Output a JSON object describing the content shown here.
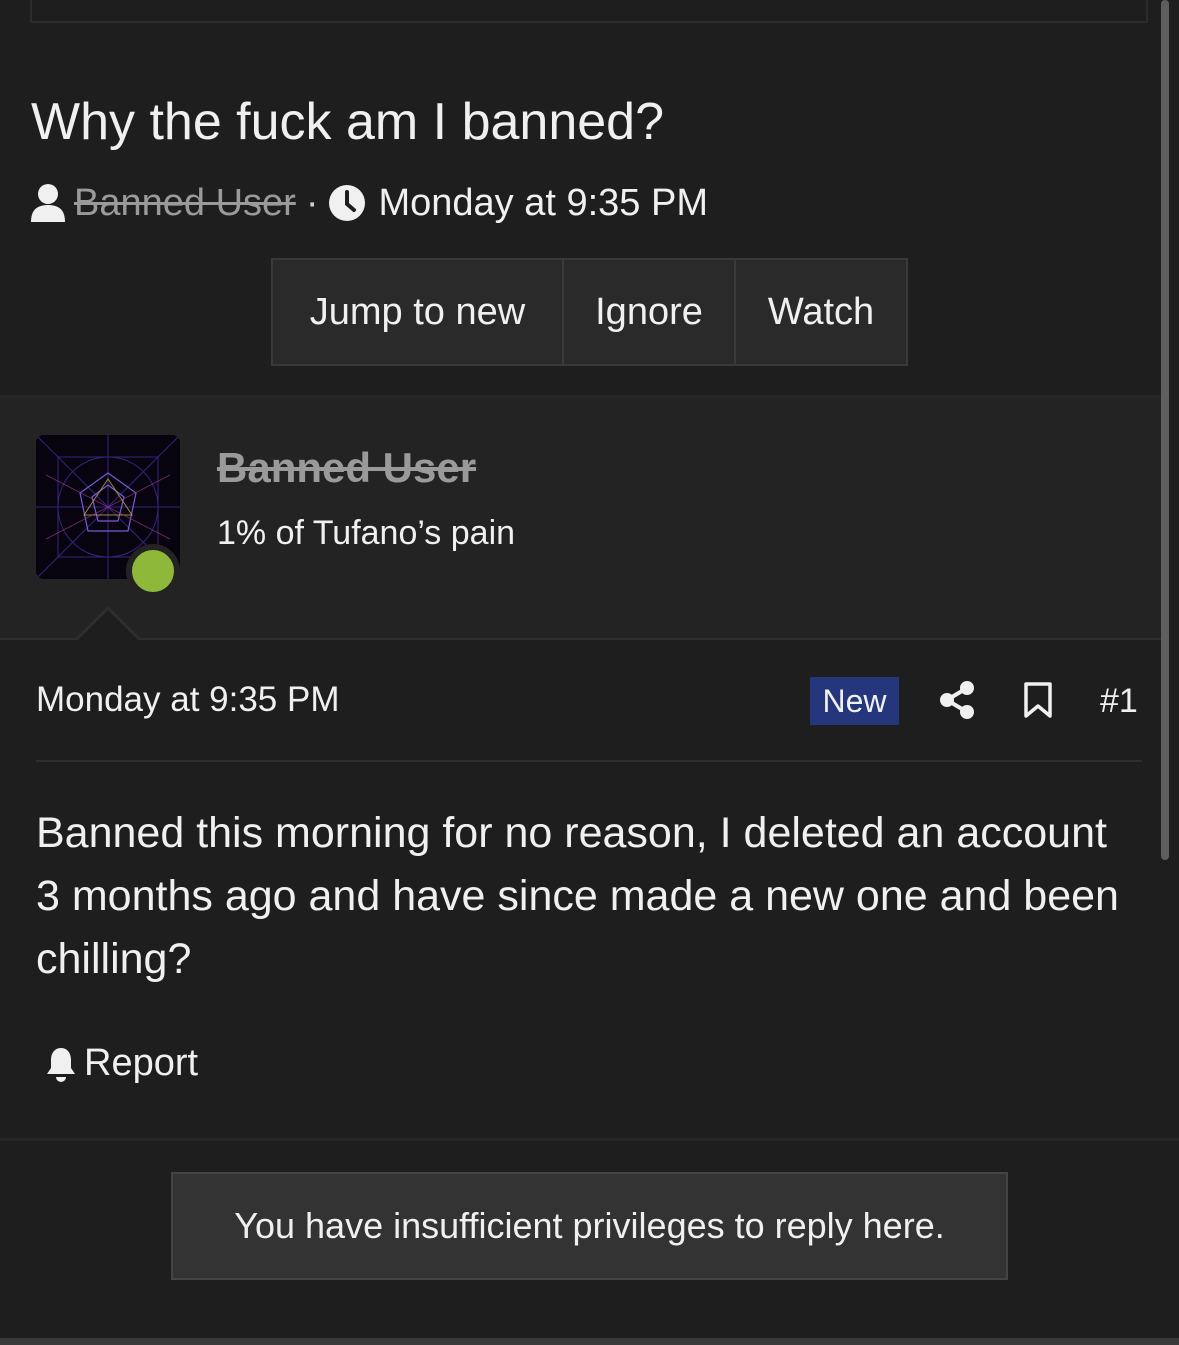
{
  "thread": {
    "title": "Why the fuck am I banned?",
    "author": "Banned User",
    "separator": "·",
    "timestamp": "Monday at 9:35 PM"
  },
  "actions": {
    "jump_label": "Jump to new",
    "ignore_label": "Ignore",
    "watch_label": "Watch"
  },
  "post": {
    "author_name": "Banned User",
    "author_title": "1% of Tufano’s pain",
    "timestamp": "Monday at 9:35 PM",
    "badge": "New",
    "number": "#1",
    "body": "Banned this morning for no reason, I deleted an account 3 months ago and have since made a new one and been chilling?",
    "report_label": "Report"
  },
  "notice": {
    "text": "You have insufficient privileges to reply here."
  },
  "icons": {
    "user": "user-icon",
    "clock": "clock-icon",
    "share": "share-icon",
    "bookmark": "bookmark-icon",
    "bell": "bell-icon"
  },
  "colors": {
    "background": "#1e1e1e",
    "panel": "#232323",
    "button": "#2a2a2a",
    "badge": "#26367d",
    "online": "#8db83a",
    "muted": "#9a9a9a"
  }
}
